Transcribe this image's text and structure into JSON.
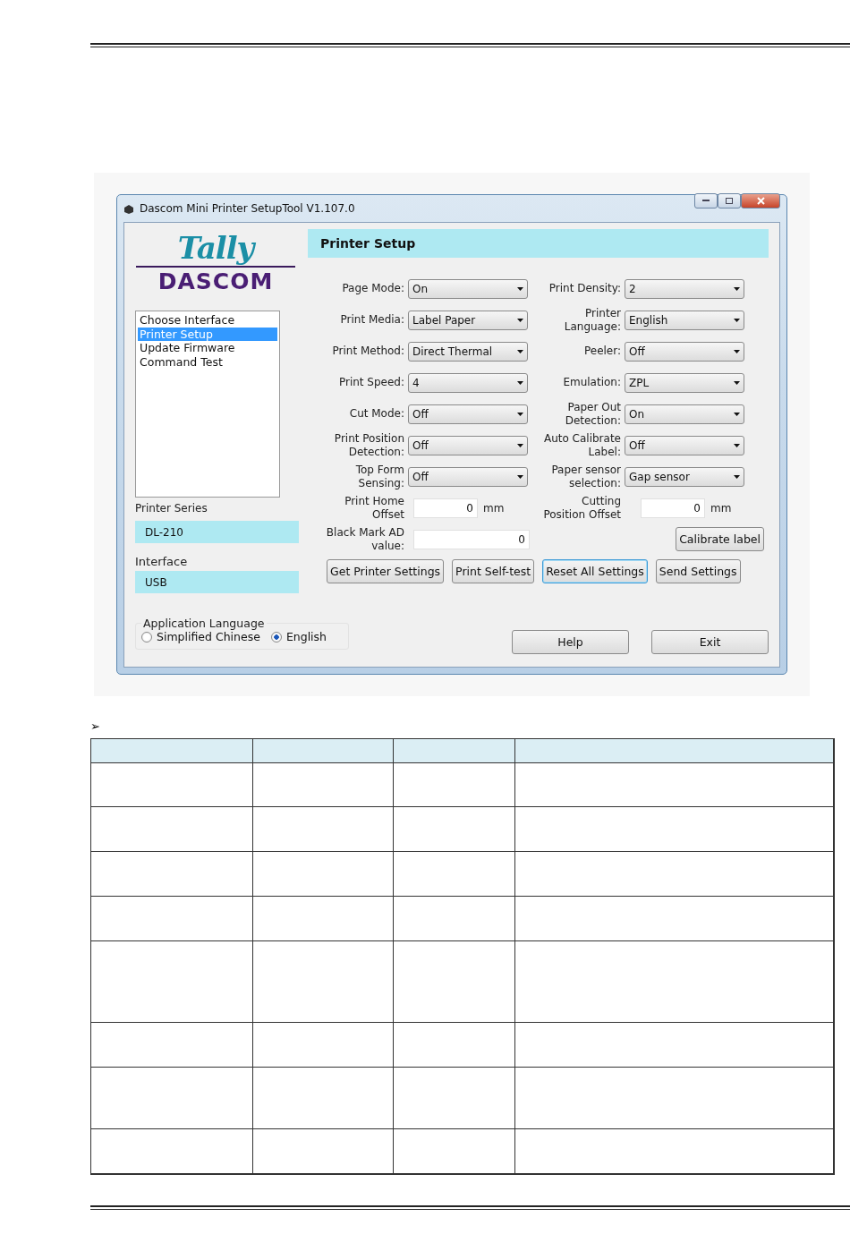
{
  "window": {
    "title": "Dascom Mini Printer SetupTool V1.107.0"
  },
  "logo": {
    "brand": "Tally",
    "company": "DASCOM"
  },
  "nav": [
    {
      "label": "Choose Interface",
      "selected": false
    },
    {
      "label": "Printer Setup",
      "selected": true
    },
    {
      "label": "Update Firmware",
      "selected": false
    },
    {
      "label": "Command Test",
      "selected": false
    }
  ],
  "printer_series": {
    "label": "Printer Series",
    "value": "DL-210"
  },
  "interface": {
    "label": "Interface",
    "value": "USB"
  },
  "app_language": {
    "label": "Application Language",
    "options": [
      {
        "label": "Simplified Chinese",
        "selected": false
      },
      {
        "label": "English",
        "selected": true
      }
    ]
  },
  "header": "Printer Setup",
  "rows": [
    {
      "left": {
        "kind": "select",
        "label": "Page Mode:",
        "value": "On"
      },
      "right": {
        "kind": "select",
        "label": "Print Density:",
        "value": "2"
      }
    },
    {
      "left": {
        "kind": "select",
        "label": "Print Media:",
        "value": "Label Paper"
      },
      "right": {
        "kind": "select",
        "label": "Printer Language:",
        "value": "English"
      }
    },
    {
      "left": {
        "kind": "select",
        "label": "Print Method:",
        "value": "Direct Thermal"
      },
      "right": {
        "kind": "select",
        "label": "Peeler:",
        "value": "Off"
      }
    },
    {
      "left": {
        "kind": "select",
        "label": "Print Speed:",
        "value": "4"
      },
      "right": {
        "kind": "select",
        "label": "Emulation:",
        "value": "ZPL"
      }
    },
    {
      "left": {
        "kind": "select",
        "label": "Cut Mode:",
        "value": "Off"
      },
      "right": {
        "kind": "select",
        "label": "Paper Out Detection:",
        "value": "On"
      }
    },
    {
      "left": {
        "kind": "select",
        "label": "Print Position Detection:",
        "value": "Off"
      },
      "right": {
        "kind": "select",
        "label": "Auto Calibrate Label:",
        "value": "Off"
      }
    },
    {
      "left": {
        "kind": "select",
        "label": "Top Form Sensing:",
        "value": "Off"
      },
      "right": {
        "kind": "select",
        "label": "Paper sensor selection:",
        "value": "Gap sensor"
      }
    },
    {
      "left": {
        "kind": "input",
        "label": "Print Home Offset",
        "value": "0",
        "unit": "mm"
      },
      "right": {
        "kind": "input",
        "label": "Cutting Position Offset",
        "value": "0",
        "unit": "mm"
      }
    },
    {
      "left": {
        "kind": "wide_input",
        "label": "Black Mark AD value:",
        "value": "0"
      },
      "right": {
        "kind": "button",
        "label": "Calibrate label"
      }
    }
  ],
  "actions": [
    {
      "label": "Get Printer Settings",
      "focused": false
    },
    {
      "label": "Print Self-test",
      "focused": false
    },
    {
      "label": "Reset All Settings",
      "focused": true
    },
    {
      "label": "Send Settings",
      "focused": false
    }
  ],
  "footer_buttons": [
    "Help",
    "Exit"
  ],
  "bullet": "➢"
}
